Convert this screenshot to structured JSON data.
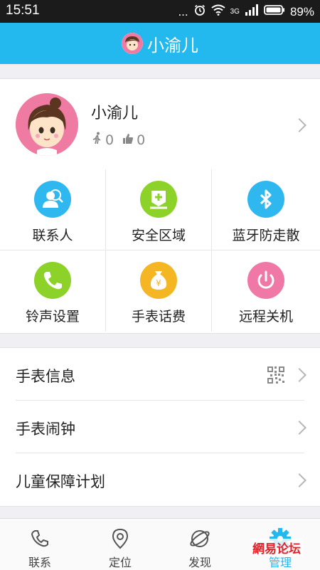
{
  "status": {
    "time": "15:51",
    "dots": "...",
    "net": "3G",
    "battery": "89%"
  },
  "title": {
    "text": "小渝儿"
  },
  "profile": {
    "name": "小渝儿",
    "steps": "0",
    "likes": "0"
  },
  "grid": {
    "items": [
      {
        "label": "联系人",
        "icon": "contacts-icon",
        "color": "#2fb8ef"
      },
      {
        "label": "安全区域",
        "icon": "safe-zone-icon",
        "color": "#8cd229"
      },
      {
        "label": "蓝牙防走散",
        "icon": "bluetooth-icon",
        "color": "#2fb8ef"
      },
      {
        "label": "铃声设置",
        "icon": "phone-icon",
        "color": "#8cd229"
      },
      {
        "label": "手表话费",
        "icon": "money-bag-icon",
        "color": "#f5b623"
      },
      {
        "label": "远程关机",
        "icon": "power-icon",
        "color": "#f078a6"
      }
    ]
  },
  "list": {
    "items": [
      "手表信息",
      "手表闹钟",
      "儿童保障计划"
    ]
  },
  "tabs": {
    "items": [
      {
        "label": "联系",
        "icon": "phone-outline-icon"
      },
      {
        "label": "定位",
        "icon": "location-pin-icon"
      },
      {
        "label": "发现",
        "icon": "discover-icon"
      },
      {
        "label": "管理",
        "icon": "gear-icon"
      }
    ]
  },
  "watermark": {
    "text": "網易论坛"
  },
  "colors": {
    "accent": "#23b9ee",
    "statusbar": "#1b1b1b"
  }
}
